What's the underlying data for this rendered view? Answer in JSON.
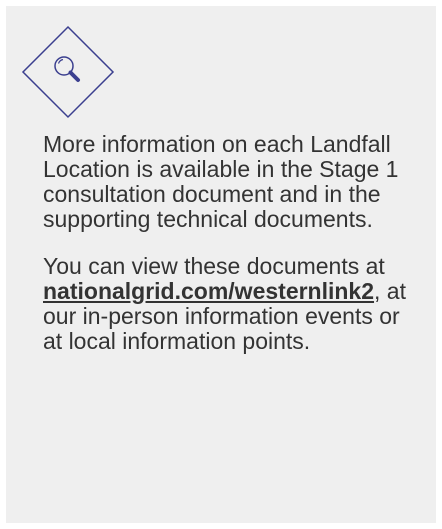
{
  "icon": {
    "name": "magnifier-icon",
    "stroke_color": "#3b3f8f"
  },
  "info": {
    "paragraph1": "More information on each Landfall Location is available in the Stage 1 consultation document and in the supporting technical documents.",
    "paragraph2_before": "You can view these documents at ",
    "link_text": "nationalgrid.com/westernlink2",
    "paragraph2_after": ", at our in-person information events or at local information points."
  }
}
